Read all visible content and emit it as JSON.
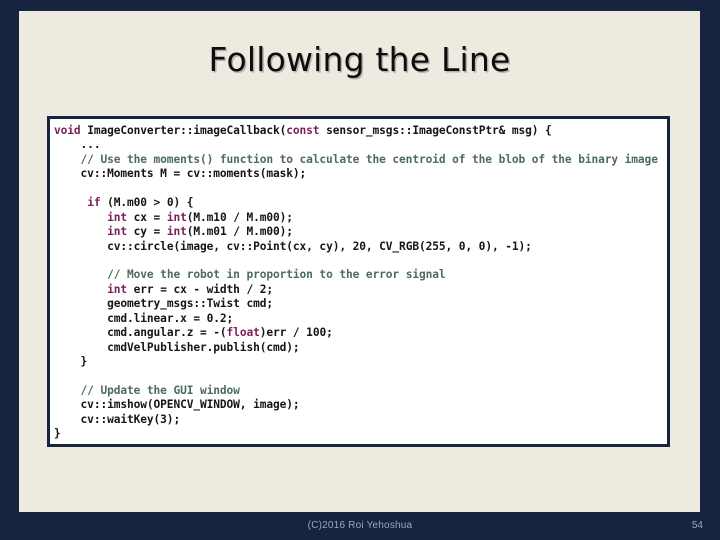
{
  "slide": {
    "title": "Following the Line",
    "background_color": "#16243f",
    "panel_color": "#edeae0"
  },
  "code_block": {
    "language": "cpp",
    "background_color": "#ffffff",
    "border_color": "#16243f",
    "keyword_color": "#7a1f5c",
    "comment_color": "#4d6b60",
    "text_color": "#151515",
    "lines": [
      {
        "indent": 0,
        "tokens": [
          {
            "t": "void ",
            "c": "kw"
          },
          {
            "t": "ImageConverter::imageCallback(",
            "c": "pl"
          },
          {
            "t": "const",
            "c": "kw"
          },
          {
            "t": " sensor_msgs::ImageConstPtr& msg) {",
            "c": "pl"
          }
        ]
      },
      {
        "indent": 1,
        "tokens": [
          {
            "t": "...",
            "c": "pl"
          }
        ]
      },
      {
        "indent": 1,
        "tokens": [
          {
            "t": "// Use the moments() function to calculate the centroid of the blob of the binary image",
            "c": "cm"
          }
        ]
      },
      {
        "indent": 1,
        "tokens": [
          {
            "t": "cv::Moments M = cv::moments(mask);",
            "c": "pl"
          }
        ]
      },
      {
        "indent": -1,
        "tokens": []
      },
      {
        "indent": 1,
        "tokens": [
          {
            "t": " ",
            "c": "pl"
          },
          {
            "t": "if",
            "c": "kw"
          },
          {
            "t": " (M.m00 > 0) {",
            "c": "pl"
          }
        ]
      },
      {
        "indent": 2,
        "tokens": [
          {
            "t": "int",
            "c": "kw"
          },
          {
            "t": " cx = ",
            "c": "pl"
          },
          {
            "t": "int",
            "c": "kw"
          },
          {
            "t": "(M.m10 / M.m00);",
            "c": "pl"
          }
        ]
      },
      {
        "indent": 2,
        "tokens": [
          {
            "t": "int",
            "c": "kw"
          },
          {
            "t": " cy = ",
            "c": "pl"
          },
          {
            "t": "int",
            "c": "kw"
          },
          {
            "t": "(M.m01 / M.m00);",
            "c": "pl"
          }
        ]
      },
      {
        "indent": 2,
        "tokens": [
          {
            "t": "cv::circle(image, cv::Point(cx, cy), 20, CV_RGB(255, 0, 0), -1);",
            "c": "pl"
          }
        ]
      },
      {
        "indent": -1,
        "tokens": []
      },
      {
        "indent": 2,
        "tokens": [
          {
            "t": "// Move the robot in proportion to the error signal",
            "c": "cm"
          }
        ]
      },
      {
        "indent": 2,
        "tokens": [
          {
            "t": "int",
            "c": "kw"
          },
          {
            "t": " err = cx - width / 2;",
            "c": "pl"
          }
        ]
      },
      {
        "indent": 2,
        "tokens": [
          {
            "t": "geometry_msgs::Twist cmd;",
            "c": "pl"
          }
        ]
      },
      {
        "indent": 2,
        "tokens": [
          {
            "t": "cmd.linear.x = 0.2;",
            "c": "pl"
          }
        ]
      },
      {
        "indent": 2,
        "tokens": [
          {
            "t": "cmd.angular.z = -(",
            "c": "pl"
          },
          {
            "t": "float",
            "c": "kw"
          },
          {
            "t": ")err / 100;",
            "c": "pl"
          }
        ]
      },
      {
        "indent": 2,
        "tokens": [
          {
            "t": "cmdVelPublisher.publish(cmd);",
            "c": "pl"
          }
        ]
      },
      {
        "indent": 1,
        "tokens": [
          {
            "t": "}",
            "c": "pl"
          }
        ]
      },
      {
        "indent": -1,
        "tokens": []
      },
      {
        "indent": 1,
        "tokens": [
          {
            "t": "// Update the GUI window",
            "c": "cm"
          }
        ]
      },
      {
        "indent": 1,
        "tokens": [
          {
            "t": "cv::imshow(OPENCV_WINDOW, image);",
            "c": "pl"
          }
        ]
      },
      {
        "indent": 1,
        "tokens": [
          {
            "t": "cv::waitKey(3);",
            "c": "pl"
          }
        ]
      },
      {
        "indent": 0,
        "tokens": [
          {
            "t": "}",
            "c": "pl"
          }
        ]
      }
    ]
  },
  "footer": {
    "credit": "(C)2016 Roi Yehoshua",
    "page_number": "54",
    "text_color": "#9aa7bb"
  }
}
